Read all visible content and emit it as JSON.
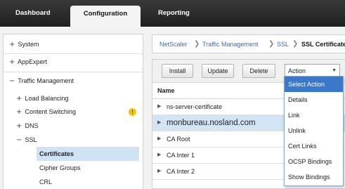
{
  "nav": {
    "tabs": [
      {
        "label": "Dashboard"
      },
      {
        "label": "Configuration"
      },
      {
        "label": "Reporting"
      }
    ],
    "active_tab": "Configuration"
  },
  "sidebar": {
    "items": [
      {
        "label": "System",
        "icon": "plus-icon",
        "expanded": false
      },
      {
        "label": "AppExpert",
        "icon": "plus-icon",
        "expanded": false
      },
      {
        "label": "Traffic Management",
        "icon": "minus-icon",
        "expanded": true
      },
      {
        "label": "Load Balancing",
        "icon": "plus-icon"
      },
      {
        "label": "Content Switching",
        "icon": "plus-icon",
        "warning": "!"
      },
      {
        "label": "DNS",
        "icon": "plus-icon"
      },
      {
        "label": "SSL",
        "icon": "minus-icon"
      },
      {
        "label": "Certificates",
        "selected": true
      },
      {
        "label": "Cipher Groups"
      },
      {
        "label": "CRL"
      }
    ],
    "icons": {
      "plus": "+",
      "minus": "−"
    }
  },
  "breadcrumb": {
    "items": [
      "NetScaler",
      "Traffic Management",
      "SSL",
      "SSL Certificate"
    ],
    "separator": "❯"
  },
  "toolbar": {
    "install_label": "Install",
    "update_label": "Update",
    "delete_label": "Delete",
    "action_select": {
      "value": "Action",
      "caret": "▼",
      "options": [
        "Select Action",
        "Details",
        "Link",
        "Unlink",
        "Cert Links",
        "OCSP Bindings",
        "Show Bindings"
      ],
      "highlighted_option": "Select Action"
    }
  },
  "table": {
    "column_header": "Name",
    "row_arrow": "▶",
    "rows": [
      {
        "name": "ns-server-certificate"
      },
      {
        "name": "monbureau.nosland.com",
        "highlighted": true
      },
      {
        "name": "CA Root"
      },
      {
        "name": "CA Inter 1"
      },
      {
        "name": "CA Inter 2"
      }
    ]
  },
  "colors": {
    "nav_bg": "#2b2b2b",
    "selected_row": "#d3e5f4",
    "menu_highlight": "#3a78c9",
    "link": "#3a6ea5",
    "warning": "#f0c419"
  }
}
